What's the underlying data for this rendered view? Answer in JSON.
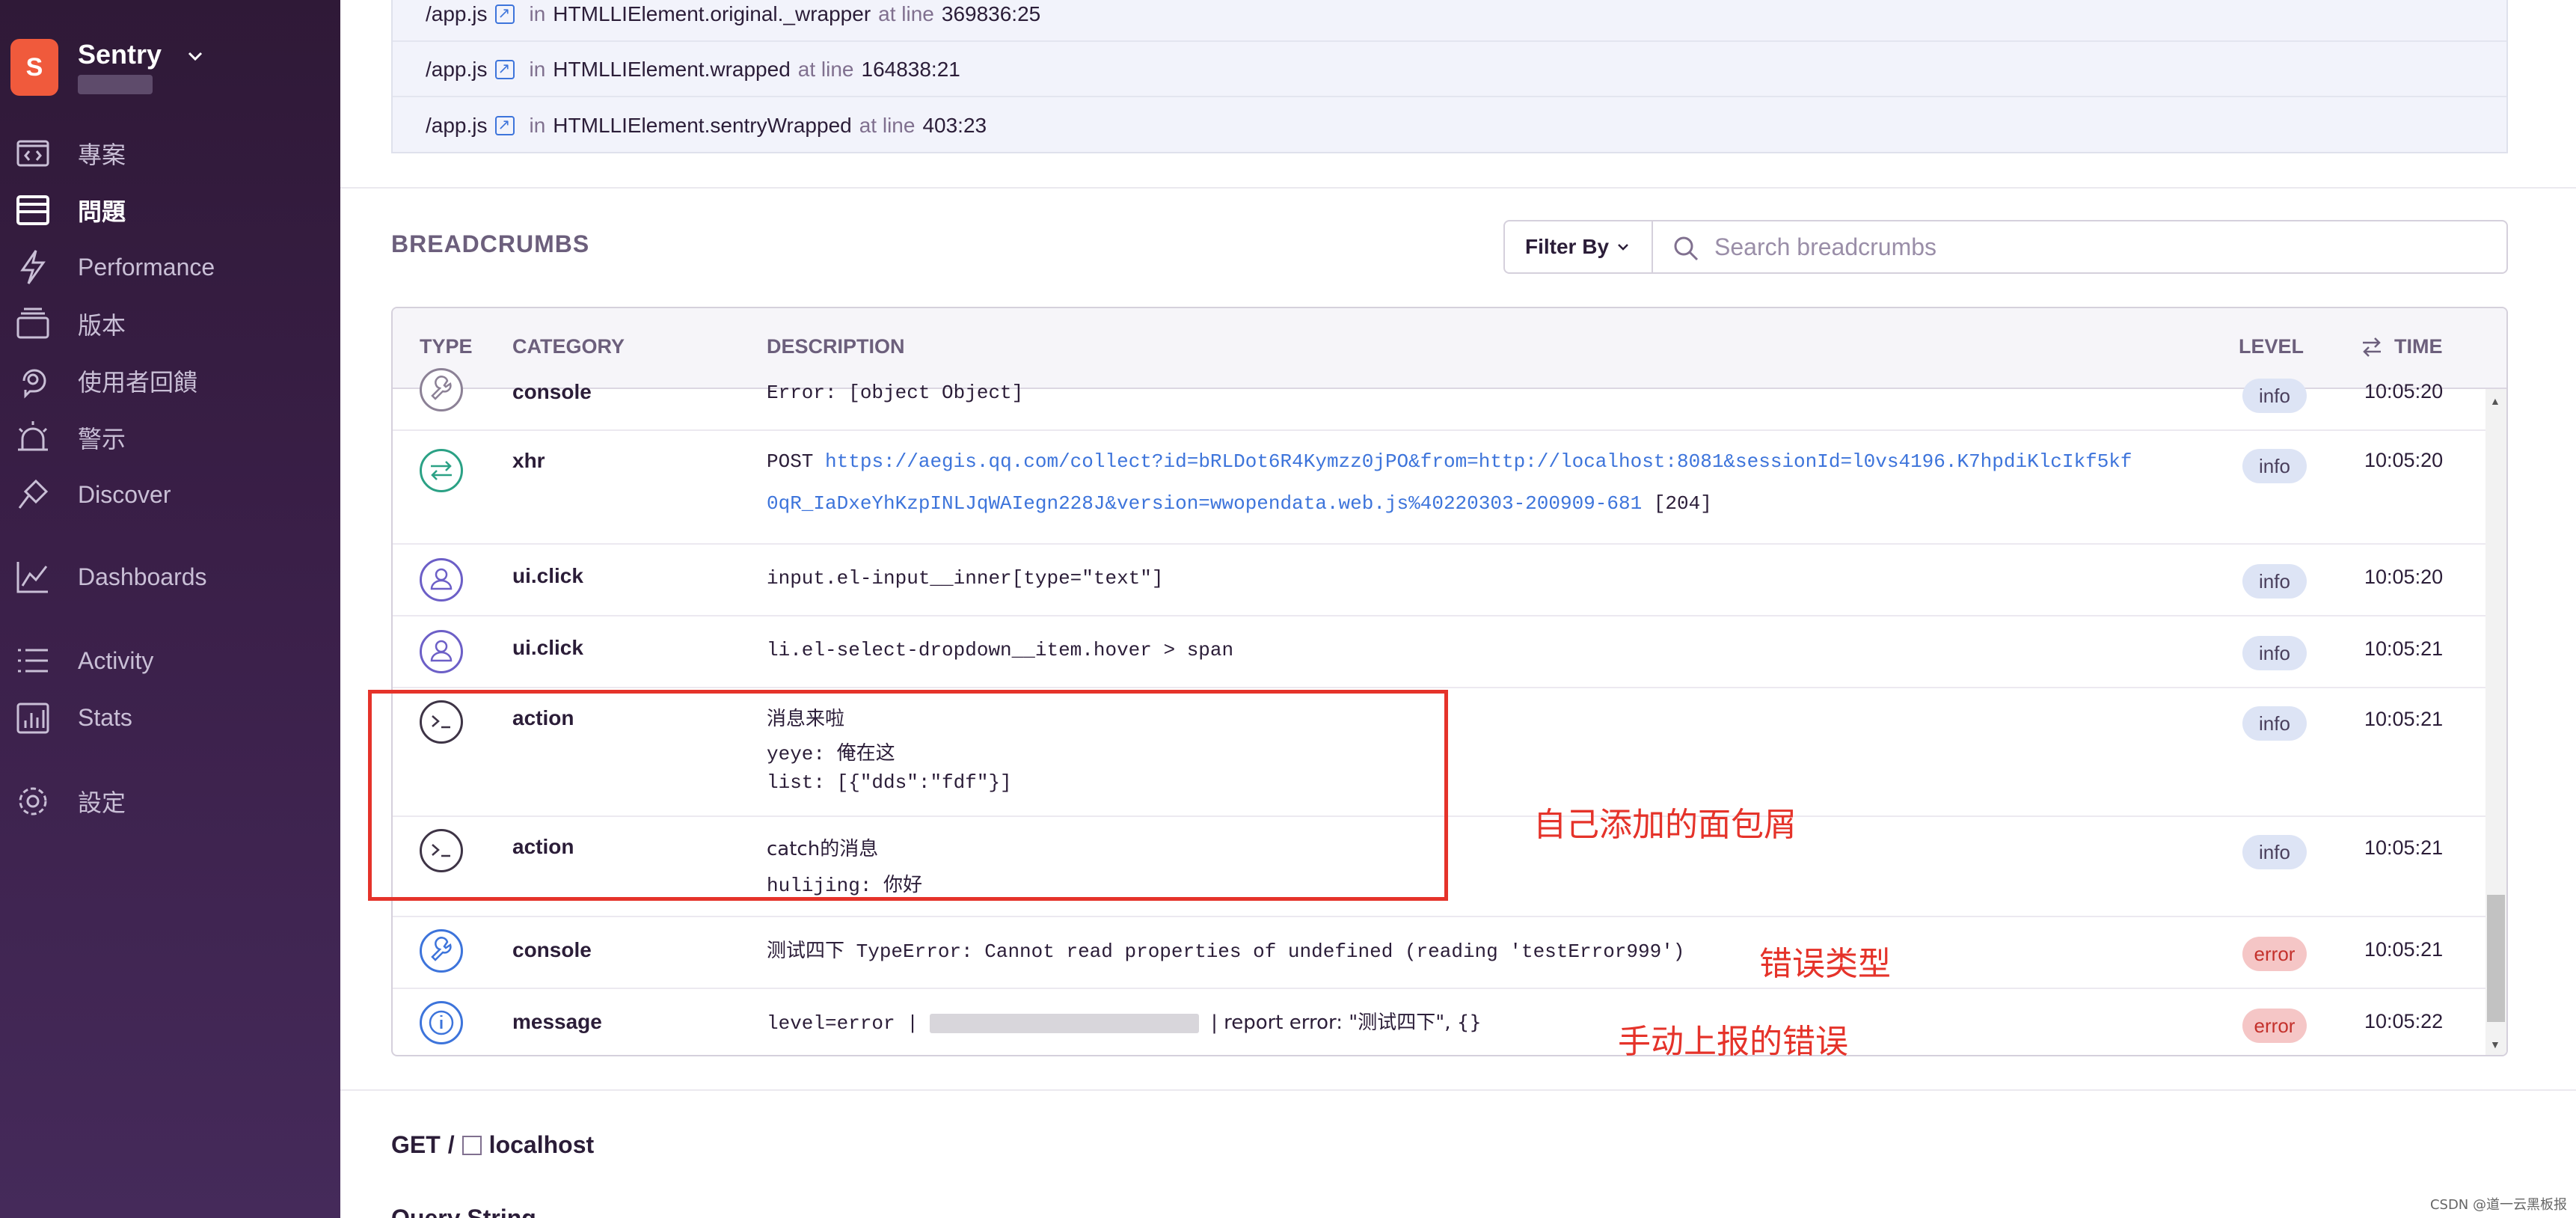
{
  "sidebar": {
    "org": {
      "initial": "S",
      "name": "Sentry"
    },
    "items": [
      {
        "label": "專案",
        "icon": "project-icon"
      },
      {
        "label": "問題",
        "icon": "issues-icon",
        "active": true
      },
      {
        "label": "Performance",
        "icon": "performance-icon"
      },
      {
        "label": "版本",
        "icon": "releases-icon"
      },
      {
        "label": "使用者回饋",
        "icon": "feedback-icon"
      },
      {
        "label": "警示",
        "icon": "alerts-icon"
      },
      {
        "label": "Discover",
        "icon": "discover-icon"
      },
      {
        "label": "Dashboards",
        "icon": "dashboards-icon"
      },
      {
        "label": "Activity",
        "icon": "activity-icon"
      },
      {
        "label": "Stats",
        "icon": "stats-icon"
      },
      {
        "label": "設定",
        "icon": "settings-icon"
      }
    ]
  },
  "frames": [
    {
      "file": "/app.js",
      "in": "in",
      "func": "HTMLLIElement.original._wrapper",
      "at": "at line",
      "line": "369836:25"
    },
    {
      "file": "/app.js",
      "in": "in",
      "func": "HTMLLIElement.wrapped",
      "at": "at line",
      "line": "164838:21"
    },
    {
      "file": "/app.js",
      "in": "in",
      "func": "HTMLLIElement.sentryWrapped",
      "at": "at line",
      "line": "403:23"
    }
  ],
  "breadcrumbs": {
    "title": "BREADCRUMBS",
    "filter_label": "Filter By",
    "search_placeholder": "Search breadcrumbs",
    "columns": {
      "type": "TYPE",
      "category": "CATEGORY",
      "description": "DESCRIPTION",
      "level": "LEVEL",
      "time": "TIME"
    },
    "rows": [
      {
        "type_icon": "wrench-icon",
        "category": "console",
        "description": "Error: [object Object]",
        "level": "info",
        "time": "10:05:20"
      },
      {
        "type_icon": "swap-arrows-icon",
        "category": "xhr",
        "method": "POST",
        "url_line1": "https://aegis.qq.com/collect?id=bRLDot6R4Kymzz0jPO&from=http://localhost:8081&sessionId=l0vs4196.K7hpdiKlcIkf5kf",
        "url_line2": "0qR_IaDxeYhKzpINLJqWAIegn228J&version=wwopendata.web.js%40220303-200909-681",
        "status": "[204]",
        "level": "info",
        "time": "10:05:20"
      },
      {
        "type_icon": "user-icon",
        "category": "ui.click",
        "description": "input.el-input__inner[type=\"text\"]",
        "level": "info",
        "time": "10:05:20"
      },
      {
        "type_icon": "user-icon",
        "category": "ui.click",
        "description": "li.el-select-dropdown__item.hover > span",
        "level": "info",
        "time": "10:05:21"
      },
      {
        "type_icon": "terminal-icon",
        "category": "action",
        "message": "消息来啦",
        "data1_key": "yeye:",
        "data1_val": "俺在这",
        "data2_key": "list:",
        "data2_val": "[{\"dds\":\"fdf\"}]",
        "level": "info",
        "time": "10:05:21"
      },
      {
        "type_icon": "terminal-icon",
        "category": "action",
        "message": "catch的消息",
        "data1_key": "hulijing:",
        "data1_val": "你好",
        "level": "info",
        "time": "10:05:21"
      },
      {
        "type_icon": "wrench-icon",
        "category": "console",
        "message": "测试四下",
        "description": "TypeError: Cannot read properties of undefined (reading 'testError999')",
        "level": "error",
        "time": "10:05:21"
      },
      {
        "type_icon": "info-circle-icon",
        "category": "message",
        "desc_pre": "level=error |",
        "desc_post": "| report error: \"测试四下\", {}",
        "level": "error",
        "time": "10:05:22"
      }
    ]
  },
  "annotations": {
    "custom_breadcrumbs": "自己添加的面包屑",
    "error_type": "错误类型",
    "manual_report": "手动上报的错误"
  },
  "request": {
    "method": "GET",
    "sep": "/",
    "host": "localhost",
    "query_title": "Query String"
  },
  "footer": {
    "watermark": "CSDN @道一云黑板报"
  },
  "colors": {
    "accent_red": "#e5332a",
    "link": "#3d74db",
    "sidebar_bg": "#2f1937"
  }
}
